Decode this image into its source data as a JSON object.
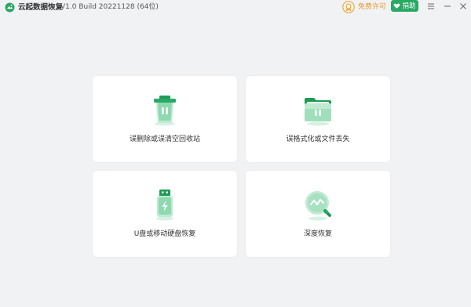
{
  "app": {
    "name": "云起数据恢复",
    "version": "V1.0 Build 20221128 (64位)"
  },
  "header": {
    "license_label": "免费许可",
    "donate_label": "捐助",
    "icons": {
      "logo": "app-logo-icon",
      "license": "license-medal-icon",
      "donate": "heart-icon",
      "menu": "menu-icon",
      "minimize": "minimize-icon",
      "close": "close-icon"
    }
  },
  "colors": {
    "background": "#f1f2f4",
    "card": "#ffffff",
    "accent_green": "#2aa865",
    "license_orange": "#e89a2c"
  },
  "cards": [
    {
      "label": "误删除或误清空回收站",
      "icon": "recycle-bin-icon"
    },
    {
      "label": "误格式化或文件丢失",
      "icon": "folder-icon"
    },
    {
      "label": "U盘或移动硬盘恢复",
      "icon": "usb-drive-icon"
    },
    {
      "label": "深度恢复",
      "icon": "deep-scan-icon"
    }
  ]
}
